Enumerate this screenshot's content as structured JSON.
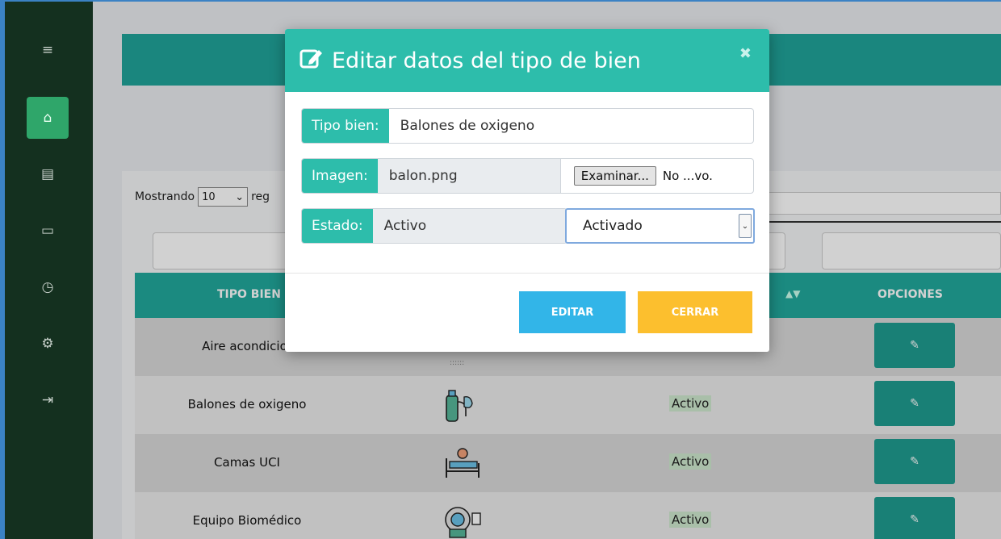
{
  "sidebar": {
    "items": [
      {
        "icon": "menu-icon",
        "glyph": "≡"
      },
      {
        "icon": "home-icon",
        "glyph": "⌂"
      },
      {
        "icon": "document-icon",
        "glyph": "▤"
      },
      {
        "icon": "folder-icon",
        "glyph": "▭"
      },
      {
        "icon": "clock-icon",
        "glyph": "◷"
      },
      {
        "icon": "gear-icon",
        "glyph": "⚙"
      },
      {
        "icon": "logout-icon",
        "glyph": "⇥"
      }
    ]
  },
  "table": {
    "show_prefix": "Mostrando",
    "page_size": "10",
    "show_suffix": "reg",
    "headers": {
      "tipo_bien": "TIPO BIEN",
      "opciones": "OPCIONES"
    },
    "rows": [
      {
        "name": "Aire acondicior",
        "status": "",
        "image": "ac-icon"
      },
      {
        "name": "Balones de oxigeno",
        "status": "Activo",
        "image": "oxygen-tank-icon"
      },
      {
        "name": "Camas UCI",
        "status": "Activo",
        "image": "hospital-bed-icon"
      },
      {
        "name": "Equipo Biomédico",
        "status": "Activo",
        "image": "biomedical-equipment-icon"
      }
    ],
    "edit_glyph": "✎"
  },
  "modal": {
    "title": "Editar datos del tipo de bien",
    "close_glyph": "✖",
    "tipo_label": "Tipo bien:",
    "tipo_value": "Balones de oxigeno",
    "imagen_label": "Imagen:",
    "imagen_value": "balon.png",
    "browse_label": "Examinar...",
    "file_status": "No ...vo.",
    "estado_label": "Estado:",
    "estado_value": "Activo",
    "estado_select": "Activado",
    "edit_button": "EDITAR",
    "close_button": "CERRAR"
  },
  "colors": {
    "accent": "#2dbdab",
    "sidebar": "#14301f",
    "edit_button": "#32b5e8",
    "close_button": "#fcbf2e"
  }
}
